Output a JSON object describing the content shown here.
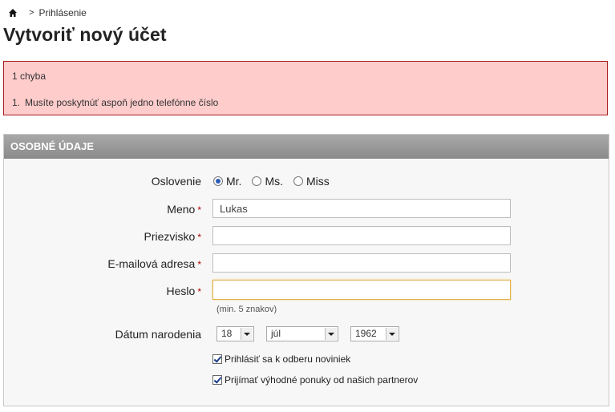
{
  "breadcrumb": {
    "home_icon": "home-icon",
    "separator": ">",
    "current": "Prihlásenie"
  },
  "page": {
    "title": "Vytvoriť nový účet"
  },
  "errors": {
    "count_text": "1 chyba",
    "items": [
      {
        "num": "1.",
        "text": "Musíte poskytnúť aspoň jedno telefónne číslo"
      }
    ]
  },
  "panel": {
    "title": "OSOBNÉ ÚDAJE"
  },
  "form": {
    "salutation": {
      "label": "Oslovenie",
      "options": [
        {
          "label": "Mr.",
          "checked": true
        },
        {
          "label": "Ms.",
          "checked": false
        },
        {
          "label": "Miss",
          "checked": false
        }
      ]
    },
    "first_name": {
      "label": "Meno",
      "required": "*",
      "value": "Lukas"
    },
    "last_name": {
      "label": "Priezvisko",
      "required": "*",
      "value": ""
    },
    "email": {
      "label": "E-mailová adresa",
      "required": "*",
      "value": ""
    },
    "password": {
      "label": "Heslo",
      "required": "*",
      "value": "",
      "hint": "(min. 5 znakov)"
    },
    "birthdate": {
      "label": "Dátum narodenia",
      "day": "18",
      "month": "júl",
      "year": "1962"
    },
    "newsletter": {
      "label": "Prihlásiť sa k odberu noviniek",
      "checked": true
    },
    "partner_offers": {
      "label": "Prijímať výhodné ponuky od našich partnerov",
      "checked": true
    }
  },
  "colors": {
    "error_bg": "#ffcccc",
    "error_border": "#a81b1b",
    "required": "#b20000",
    "header_grad_top": "#a9a9a9",
    "header_grad_bottom": "#8a8a8a"
  }
}
